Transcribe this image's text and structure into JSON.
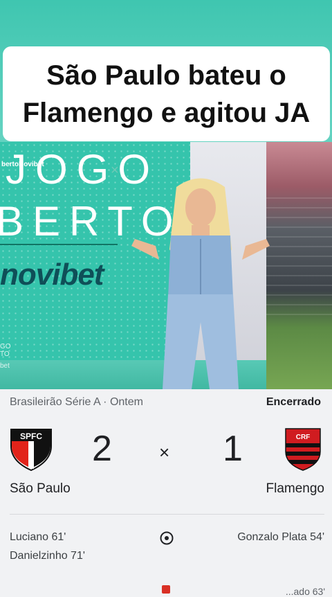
{
  "video": {
    "caption": "São Paulo bateu o Flamengo e agitou JA",
    "handle": "bertoNovibet",
    "brand_line1": "JOGO",
    "brand_x": "×",
    "brand_line2": "BERTO",
    "sponsor": "novibet",
    "small_brand_1": "GO",
    "small_brand_2": "TO",
    "small_brand_3": "bet"
  },
  "match": {
    "competition": "Brasileirão Série A · Ontem",
    "status": "Encerrado",
    "home_team": "São Paulo",
    "away_team": "Flamengo",
    "home_score": "2",
    "away_score": "1",
    "separator": "×",
    "home_crest_text": "SPFC",
    "away_crest_text": "CRF",
    "home_goals": [
      "Luciano 61'",
      "Danielzinho 71'"
    ],
    "away_goals": [
      "Gonzalo Plata 54'"
    ],
    "cut_text": "...ado 63'"
  },
  "icons": {
    "goal": "soccer-ball-icon",
    "card": "red-card-icon"
  },
  "colors": {
    "spfc_red": "#e2231a",
    "flamengo_red": "#d01c20",
    "flamengo_black": "#111111",
    "video_teal": "#35c4ac"
  }
}
